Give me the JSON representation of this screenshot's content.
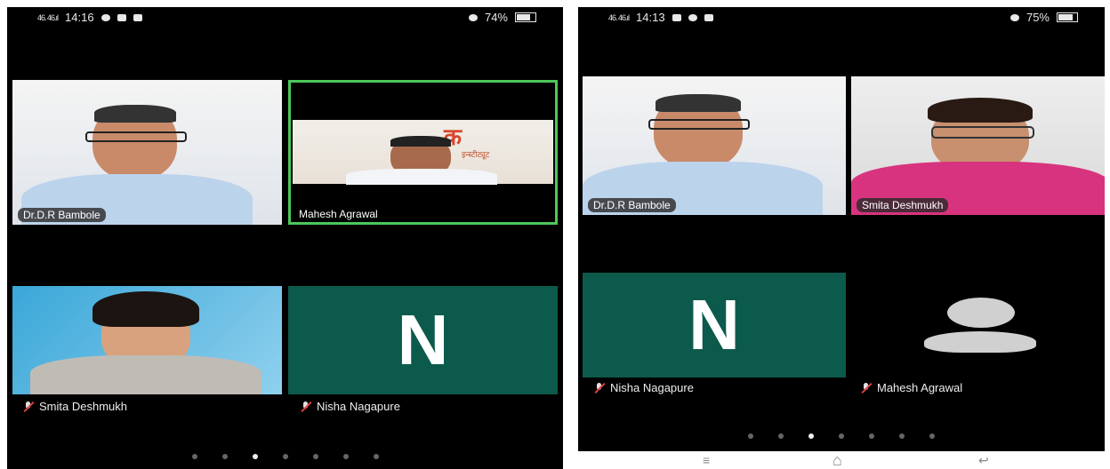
{
  "left": {
    "status": {
      "time": "14:16",
      "signal": "46. 46.ıl",
      "battery": "74%"
    },
    "tiles": [
      {
        "name": "Dr.D.R Bambole",
        "speaking": false
      },
      {
        "name": "Mahesh Agrawal",
        "speaking": true,
        "banner_text": "क",
        "banner_sub": "इन्स्टीट्यूट"
      },
      {
        "name": "Smita Deshmukh",
        "muted": true
      },
      {
        "name": "Nisha Nagapure",
        "muted": true,
        "avatar_letter": "N"
      }
    ],
    "pages": 7,
    "active_page": 3
  },
  "right": {
    "status": {
      "time": "14:13",
      "signal": "46. 46.ıl",
      "battery": "75%"
    },
    "tiles": [
      {
        "name": "Dr.D.R Bambole",
        "speaking": false
      },
      {
        "name": "Smita Deshmukh",
        "speaking": true
      },
      {
        "name": "Nisha Nagapure",
        "muted": true,
        "avatar_letter": "N"
      },
      {
        "name": "Mahesh Agrawal",
        "muted": true
      }
    ],
    "pages": 7,
    "active_page": 3
  },
  "navbar": {
    "recent": "≡",
    "home": "⌂",
    "back": "↩"
  },
  "colors": {
    "speaking_border": "#4cc85a",
    "avatar_bg": "#0c5a4b"
  }
}
